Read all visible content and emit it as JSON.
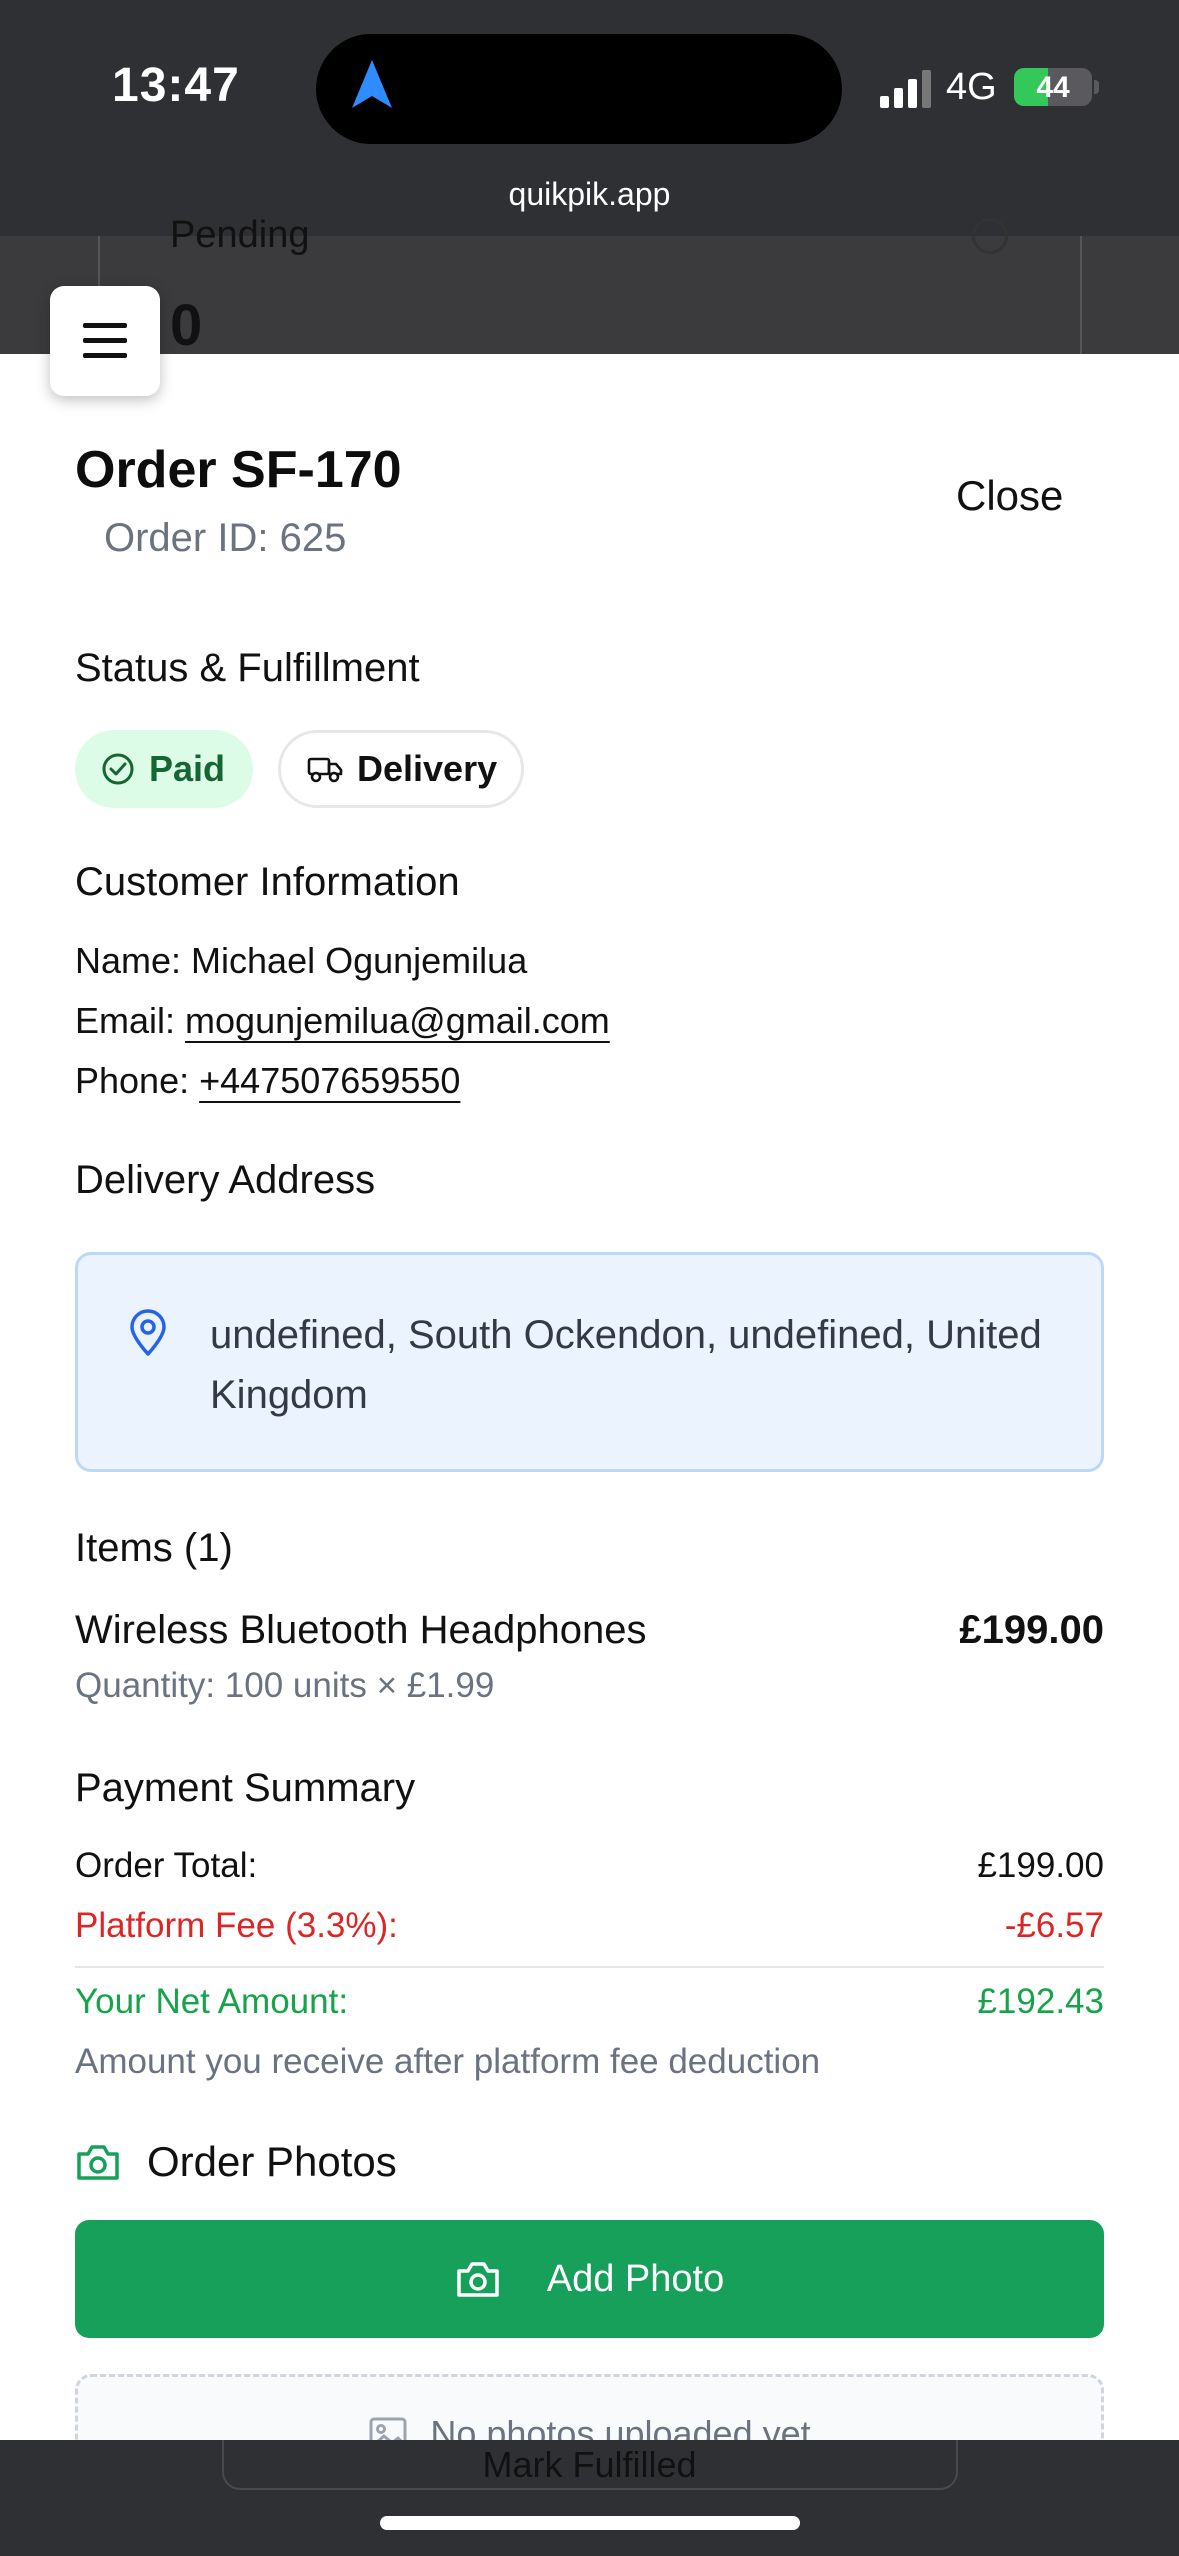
{
  "status_bar": {
    "time": "13:47",
    "network": "4G",
    "battery_percent": "44",
    "battery_level": 0.44
  },
  "browser": {
    "url": "quikpik.app"
  },
  "background_page": {
    "card_label": "Pending",
    "card_count": "0",
    "bottom_button": "Mark Fulfilled"
  },
  "modal": {
    "title": "Order SF-170",
    "order_id": "Order ID: 625",
    "close_label": "Close",
    "status_section": {
      "heading": "Status & Fulfillment",
      "payment_badge": "Paid",
      "fulfillment_badge": "Delivery"
    },
    "customer": {
      "heading": "Customer Information",
      "name_label": "Name:",
      "name": "Michael Ogunjemilua",
      "email_label": "Email:",
      "email": "mogunjemilua@gmail.com",
      "phone_label": "Phone:",
      "phone": "+447507659550"
    },
    "delivery": {
      "heading": "Delivery Address",
      "address": "undefined, South Ockendon, undefined, United Kingdom"
    },
    "items": {
      "heading": "Items (1)",
      "list": [
        {
          "name": "Wireless Bluetooth Headphones",
          "price": "£199.00",
          "quantity": "Quantity: 100 units × £1.99"
        }
      ]
    },
    "payment": {
      "heading": "Payment Summary",
      "order_total_label": "Order Total:",
      "order_total": "£199.00",
      "fee_label": "Platform Fee (3.3%):",
      "fee": "-£6.57",
      "net_label": "Your Net Amount:",
      "net": "£192.43",
      "note": "Amount you receive after platform fee deduction"
    },
    "photos": {
      "heading": "Order Photos",
      "add_button": "Add Photo",
      "empty_text": "No photos uploaded yet"
    }
  },
  "colors": {
    "green": "#16a05a",
    "paid_bg": "#dcfce7",
    "fee_red": "#dc2626",
    "net_green": "#16a34a",
    "address_bg": "#eaf3fe",
    "pin_blue": "#2563eb"
  }
}
